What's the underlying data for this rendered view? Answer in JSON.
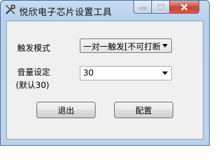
{
  "window": {
    "title": "悦欣电子芯片设置工具"
  },
  "form": {
    "trigger_mode_label": "触发模式",
    "trigger_mode_value": "一对一触发[不可打断",
    "volume_label": "音量设定",
    "volume_default_note": "(默认30)",
    "volume_value": "30"
  },
  "buttons": {
    "exit_label": "退出",
    "config_label": "配置"
  },
  "colors": {
    "titlebar": "#bcd3ec",
    "close_button": "#c6463a",
    "client_bg": "#f0f0f0"
  }
}
